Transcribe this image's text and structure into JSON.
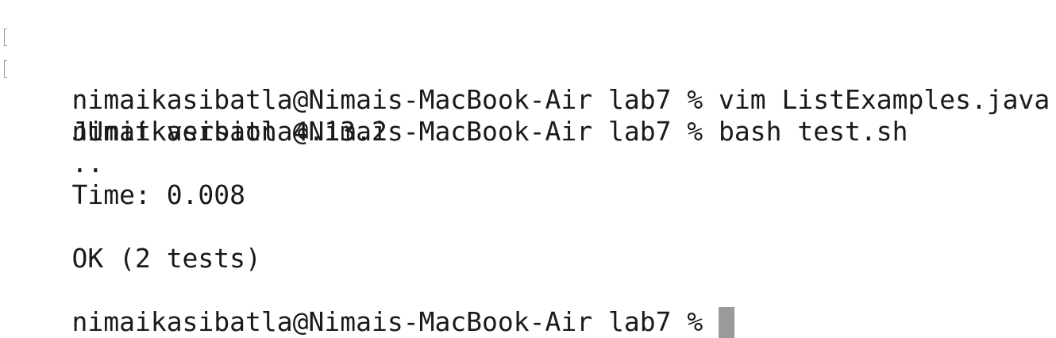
{
  "terminal": {
    "lines": [
      {
        "text": "nimaikasibatla@Nimais-MacBook-Air lab7 % vim ListExamples.java",
        "marked": true
      },
      {
        "text": "nimaikasibatla@Nimais-MacBook-Air lab7 % bash test.sh",
        "marked": true
      },
      {
        "text": "JUnit version 4.13.2",
        "marked": false
      },
      {
        "text": "..",
        "marked": false
      },
      {
        "text": "Time: 0.008",
        "marked": false
      },
      {
        "text": "",
        "marked": false
      },
      {
        "text": "OK (2 tests)",
        "marked": false
      },
      {
        "text": "",
        "marked": false
      }
    ],
    "prompt": "nimaikasibatla@Nimais-MacBook-Air lab7 % ",
    "colors": {
      "background": "#ffffff",
      "text": "#1a1a1a",
      "cursor": "#9a9a9a"
    }
  }
}
